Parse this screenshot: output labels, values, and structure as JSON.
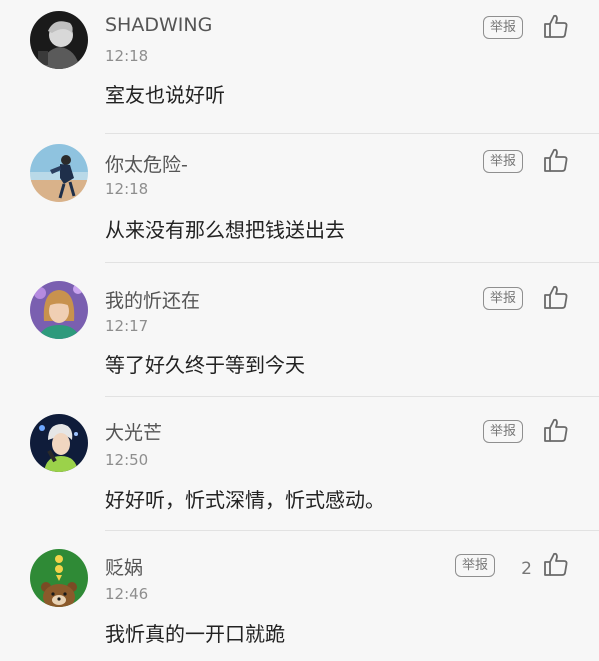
{
  "comments": [
    {
      "user": "SHADWING",
      "time": "12:18",
      "text": "室友也说好听",
      "report": "举报",
      "likes": "",
      "avatar_icon": "portrait-dark-avatar"
    },
    {
      "user": "你太危险-",
      "time": "12:18",
      "text": "从来没有那么想把钱送出去",
      "report": "举报",
      "likes": "",
      "avatar_icon": "beach-figure-avatar"
    },
    {
      "user": "我的忻还在",
      "time": "12:17",
      "text": "等了好久终于等到今天",
      "report": "举报",
      "likes": "",
      "avatar_icon": "girl-bangs-avatar"
    },
    {
      "user": "大光芒",
      "time": "12:50",
      "text": "好好听，忻式深情，忻式感动。",
      "report": "举报",
      "likes": "",
      "avatar_icon": "singer-mic-avatar"
    },
    {
      "user": "贬娲",
      "time": "12:46",
      "text": "我忻真的一开口就跪",
      "report": "举报",
      "likes": "2",
      "avatar_icon": "bear-cartoon-avatar"
    }
  ]
}
